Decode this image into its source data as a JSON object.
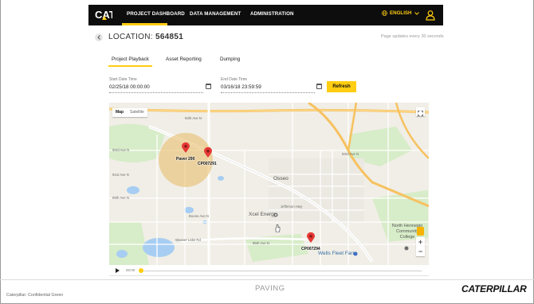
{
  "nav": {
    "logo_text": "CAT",
    "items": [
      {
        "label": "PROJECT DASHBOARD"
      },
      {
        "label": "DATA MANAGEMENT"
      },
      {
        "label": "ADMINISTRATION"
      }
    ],
    "language": "ENGLISH"
  },
  "header": {
    "location_label": "LOCATION:",
    "location_id": "564851",
    "page_updates": "Page updates every 30 seconds"
  },
  "tabs": [
    {
      "label": "Project Playback",
      "active": true
    },
    {
      "label": "Asset Reporting",
      "active": false
    },
    {
      "label": "Dumping",
      "active": false
    }
  ],
  "filters": {
    "start_label": "Start Date Time",
    "start_value": "02/25/18 00:00:00",
    "end_label": "End Date Time",
    "end_value": "03/16/18 23:59:59",
    "refresh_label": "Refresh"
  },
  "map": {
    "toggle_map": "Map",
    "toggle_satellite": "Satellite",
    "pins": [
      {
        "label": "Paver 290"
      },
      {
        "label": "CP007291"
      },
      {
        "label": "CP007294"
      }
    ],
    "pois": [
      {
        "label": "Xcel Energy"
      },
      {
        "label": "Wells Fleet Farm"
      },
      {
        "label": "North Hennepin Community College"
      },
      {
        "label": "Osseo"
      }
    ],
    "streets": [
      {
        "label": "93rd Ave N"
      },
      {
        "label": "93rd Ave N"
      },
      {
        "label": "94th Ave N"
      },
      {
        "label": "91st Ave N"
      },
      {
        "label": "89th Ave N"
      },
      {
        "label": "85th Ave N"
      },
      {
        "label": "Weaver Lake Rd"
      },
      {
        "label": "Boone Ave N"
      },
      {
        "label": "Jefferson Hwy"
      }
    ],
    "zoom_in": "+",
    "zoom_out": "−"
  },
  "playback": {
    "time": "00:00"
  },
  "footer": {
    "confidential": "Caterpillar: Confidential Green",
    "section": "PAVING",
    "brand": "CATERPILLAR"
  },
  "colors": {
    "accent": "#ffcd11",
    "nav_bg": "#0d0d0d",
    "pin": "#e53935"
  }
}
